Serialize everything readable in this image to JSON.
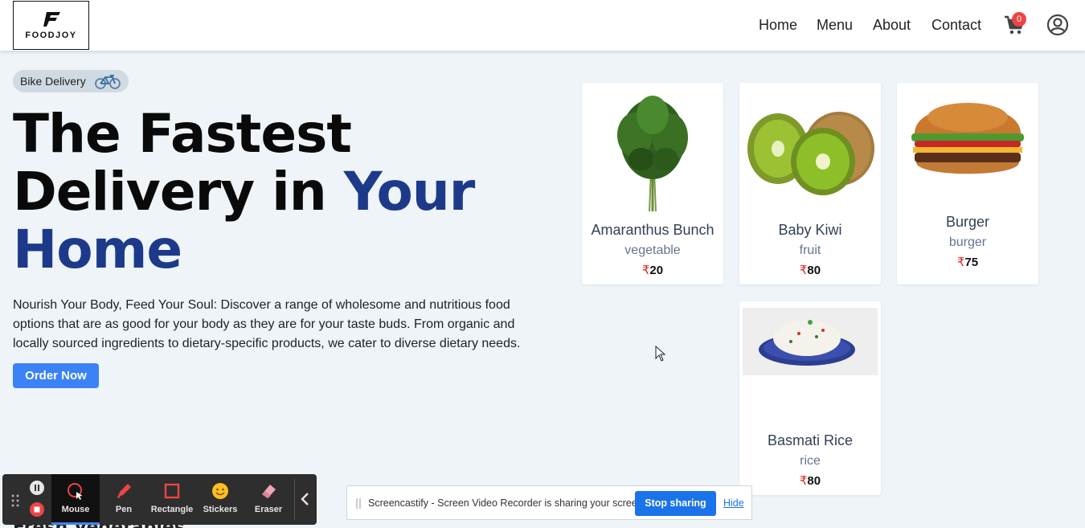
{
  "header": {
    "logo_text": "FOODJOY",
    "nav": [
      "Home",
      "Menu",
      "About",
      "Contact"
    ],
    "cart_count": "0"
  },
  "hero": {
    "badge": "Bike Delivery",
    "headline_line1": "The Fastest",
    "headline_line2_plain": "Delivery in ",
    "headline_line2_accent": "Your",
    "headline_line3_accent": "Home",
    "description": "Nourish Your Body, Feed Your Soul: Discover a range of wholesome and nutritious food options that are as good for your body as they are for your taste buds. From organic and locally sourced ingredients to dietary-specific products, we cater to diverse dietary needs.",
    "cta": "Order Now"
  },
  "products": [
    {
      "name": "Amaranthus Bunch",
      "category": "vegetable",
      "currency": "₹",
      "price": "20",
      "image": "leafy-greens"
    },
    {
      "name": "Baby Kiwi",
      "category": "fruit",
      "currency": "₹",
      "price": "80",
      "image": "kiwi"
    },
    {
      "name": "Burger",
      "category": "burger",
      "currency": "₹",
      "price": "75",
      "image": "burger"
    },
    {
      "name": "Basmati Rice",
      "category": "rice",
      "currency": "₹",
      "price": "80",
      "image": "rice-plate"
    }
  ],
  "section_peek": "Fresh Vegetables",
  "recorder": {
    "tools": [
      "Mouse",
      "Pen",
      "Rectangle",
      "Stickers",
      "Eraser"
    ],
    "active_tool": "Mouse"
  },
  "sharebar": {
    "message": "Screencastify - Screen Video Recorder is sharing your screen.",
    "stop_label": "Stop sharing",
    "hide_label": "Hide"
  },
  "colors": {
    "accent_blue": "#1d3a8a",
    "button_blue": "#3b82f6",
    "price_currency": "#dc2626",
    "page_bg": "#eef4f8"
  }
}
